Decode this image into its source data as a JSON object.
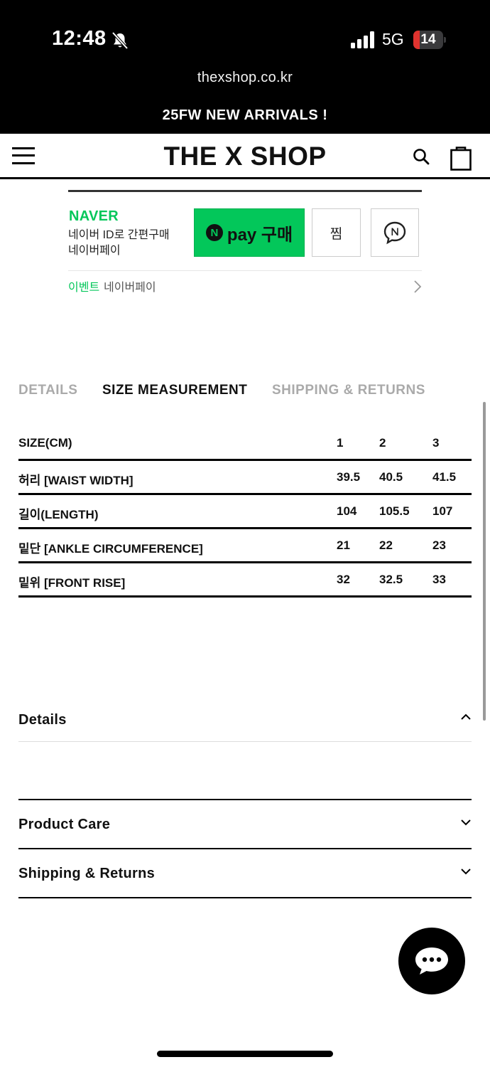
{
  "status_bar": {
    "time": "12:48",
    "network": "5G",
    "battery": "14",
    "battery_level": 0.14,
    "battery_color": "#e0332f"
  },
  "browser": {
    "url": "thexshop.co.kr"
  },
  "announcement": {
    "text": "25FW NEW ARRIVALS !"
  },
  "header": {
    "logo": "THE X SHOP",
    "menu_icon": "hamburger-menu-icon",
    "search_icon": "search-icon",
    "cart_icon": "shopping-bag-icon"
  },
  "naver_pay": {
    "brand": "NAVER",
    "desc_line1": "네이버 ID로 간편구매",
    "desc_line2": "네이버페이",
    "pay_n": "N",
    "pay_label": "pay 구매",
    "wish_label": "찜",
    "talk_icon": "naver-talktalk-icon",
    "event_tag": "이벤트",
    "event_text": "네이버페이",
    "accent_color": "#03c75a"
  },
  "tabs": [
    {
      "label": "DETAILS",
      "active": false
    },
    {
      "label": "SIZE MEASUREMENT",
      "active": true
    },
    {
      "label": "SHIPPING & RETURNS",
      "active": false
    }
  ],
  "size_table": {
    "header": [
      "SIZE(CM)",
      "1",
      "2",
      "3"
    ],
    "rows": [
      [
        "허리 [WAIST WIDTH]",
        "39.5",
        "40.5",
        "41.5"
      ],
      [
        "길이(LENGTH)",
        "104",
        "105.5",
        "107"
      ],
      [
        "밑단 [ANKLE CIRCUMFERENCE]",
        "21",
        "22",
        "23"
      ],
      [
        "밑위 [FRONT RISE]",
        "32",
        "32.5",
        "33"
      ]
    ]
  },
  "accordions": [
    {
      "title": "Details",
      "expanded": true
    },
    {
      "title": "Product Care",
      "expanded": false
    },
    {
      "title": "Shipping & Returns",
      "expanded": false
    }
  ],
  "chat": {
    "icon": "chat-bubble-icon"
  }
}
